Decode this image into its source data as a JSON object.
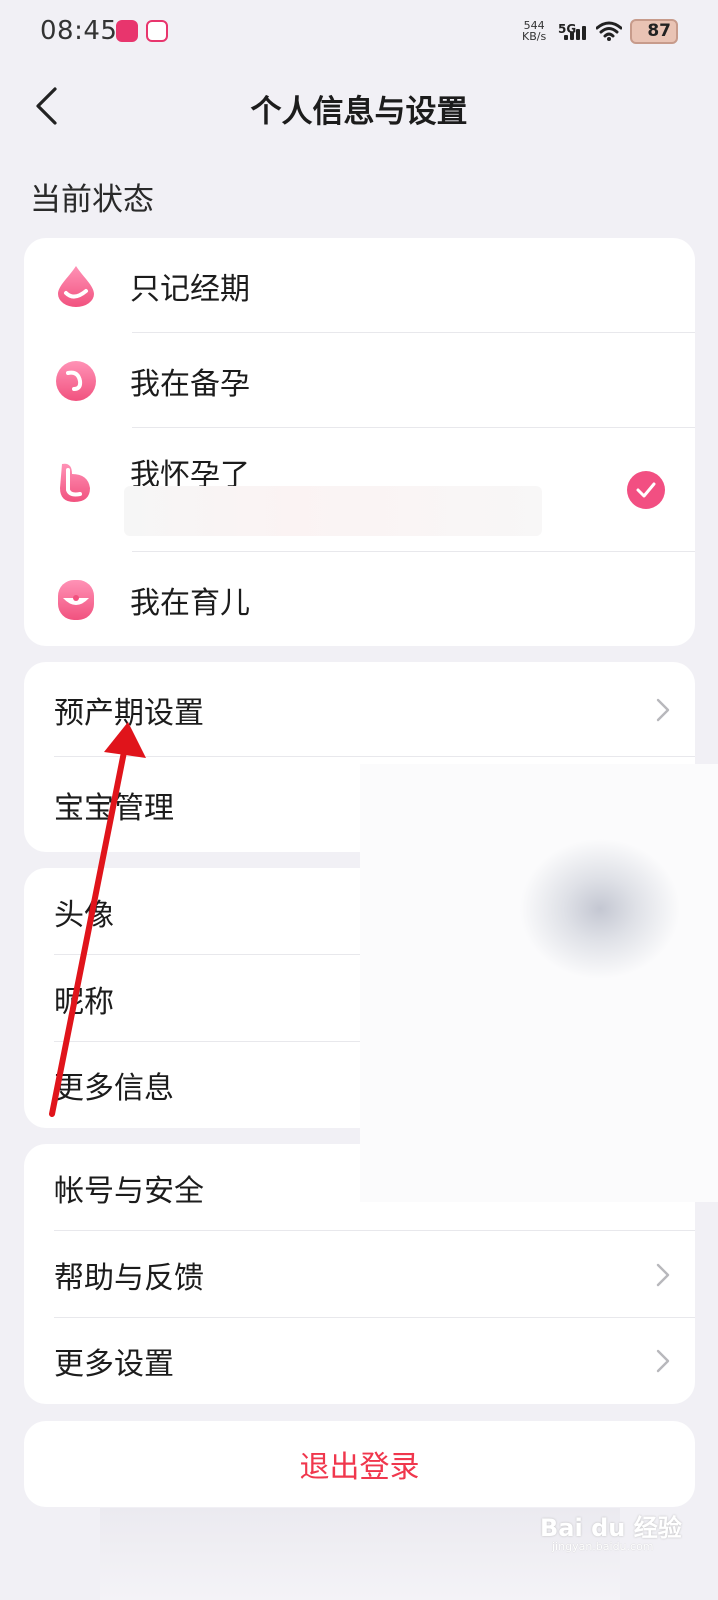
{
  "status_bar": {
    "time": "08:45",
    "net_speed": "544",
    "net_unit": "KB/s",
    "network": "5G",
    "battery": "87",
    "icons": [
      "app-notification-icon",
      "video-app-icon",
      "signal-icon",
      "wifi-icon",
      "battery-icon"
    ]
  },
  "header": {
    "title": "个人信息与设置",
    "back_icon": "chevron-left-icon"
  },
  "section_label": "当前状态",
  "status_options": [
    {
      "label": "只记经期",
      "icon": "period-drop-icon",
      "selected": false
    },
    {
      "label": "我在备孕",
      "icon": "prepare-pregnancy-icon",
      "selected": false
    },
    {
      "label": "我怀孕了",
      "icon": "pregnant-icon",
      "selected": true
    },
    {
      "label": "我在育儿",
      "icon": "parenting-icon",
      "selected": false
    }
  ],
  "baby_menu": [
    {
      "label": "预产期设置",
      "chevron": true
    },
    {
      "label": "宝宝管理",
      "chevron": false
    }
  ],
  "profile_menu": [
    {
      "label": "头像"
    },
    {
      "label": "昵称"
    },
    {
      "label": "更多信息"
    }
  ],
  "account_menu": [
    {
      "label": "帐号与安全",
      "chevron": false
    },
    {
      "label": "帮助与反馈",
      "chevron": true
    },
    {
      "label": "更多设置",
      "chevron": true
    }
  ],
  "logout_label": "退出登录",
  "watermark": {
    "text": "Bai du 经验",
    "sub": "jingyan.baidu.com"
  },
  "colors": {
    "accent_pink": "#f24f82",
    "logout_red": "#f0374d",
    "page_bg": "#f1f0f5",
    "annotation_arrow": "#e0141b"
  }
}
